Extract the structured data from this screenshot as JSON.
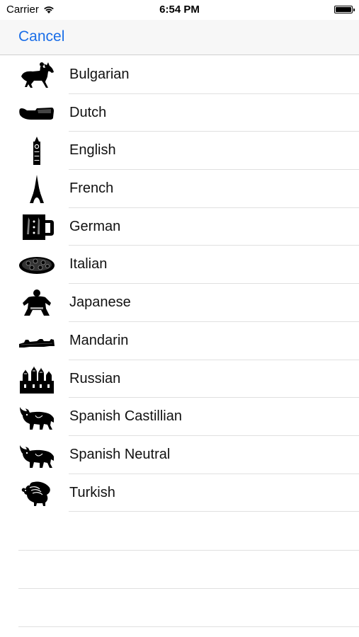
{
  "status_bar": {
    "carrier": "Carrier",
    "time": "6:54 PM",
    "battery_level": 1.0
  },
  "nav": {
    "cancel_label": "Cancel",
    "accent_color": "#1a6ee8"
  },
  "languages": [
    {
      "label": "Bulgarian",
      "icon": "horse-rider-icon"
    },
    {
      "label": "Dutch",
      "icon": "wooden-shoe-icon"
    },
    {
      "label": "English",
      "icon": "big-ben-icon"
    },
    {
      "label": "French",
      "icon": "eiffel-tower-icon"
    },
    {
      "label": "German",
      "icon": "beer-mug-icon"
    },
    {
      "label": "Italian",
      "icon": "pizza-icon"
    },
    {
      "label": "Japanese",
      "icon": "sumo-wrestler-icon"
    },
    {
      "label": "Mandarin",
      "icon": "great-wall-icon"
    },
    {
      "label": "Russian",
      "icon": "cathedral-icon"
    },
    {
      "label": "Spanish Castillian",
      "icon": "bull-icon"
    },
    {
      "label": "Spanish Neutral",
      "icon": "bull-icon"
    },
    {
      "label": "Turkish",
      "icon": "turkey-bird-icon"
    }
  ]
}
